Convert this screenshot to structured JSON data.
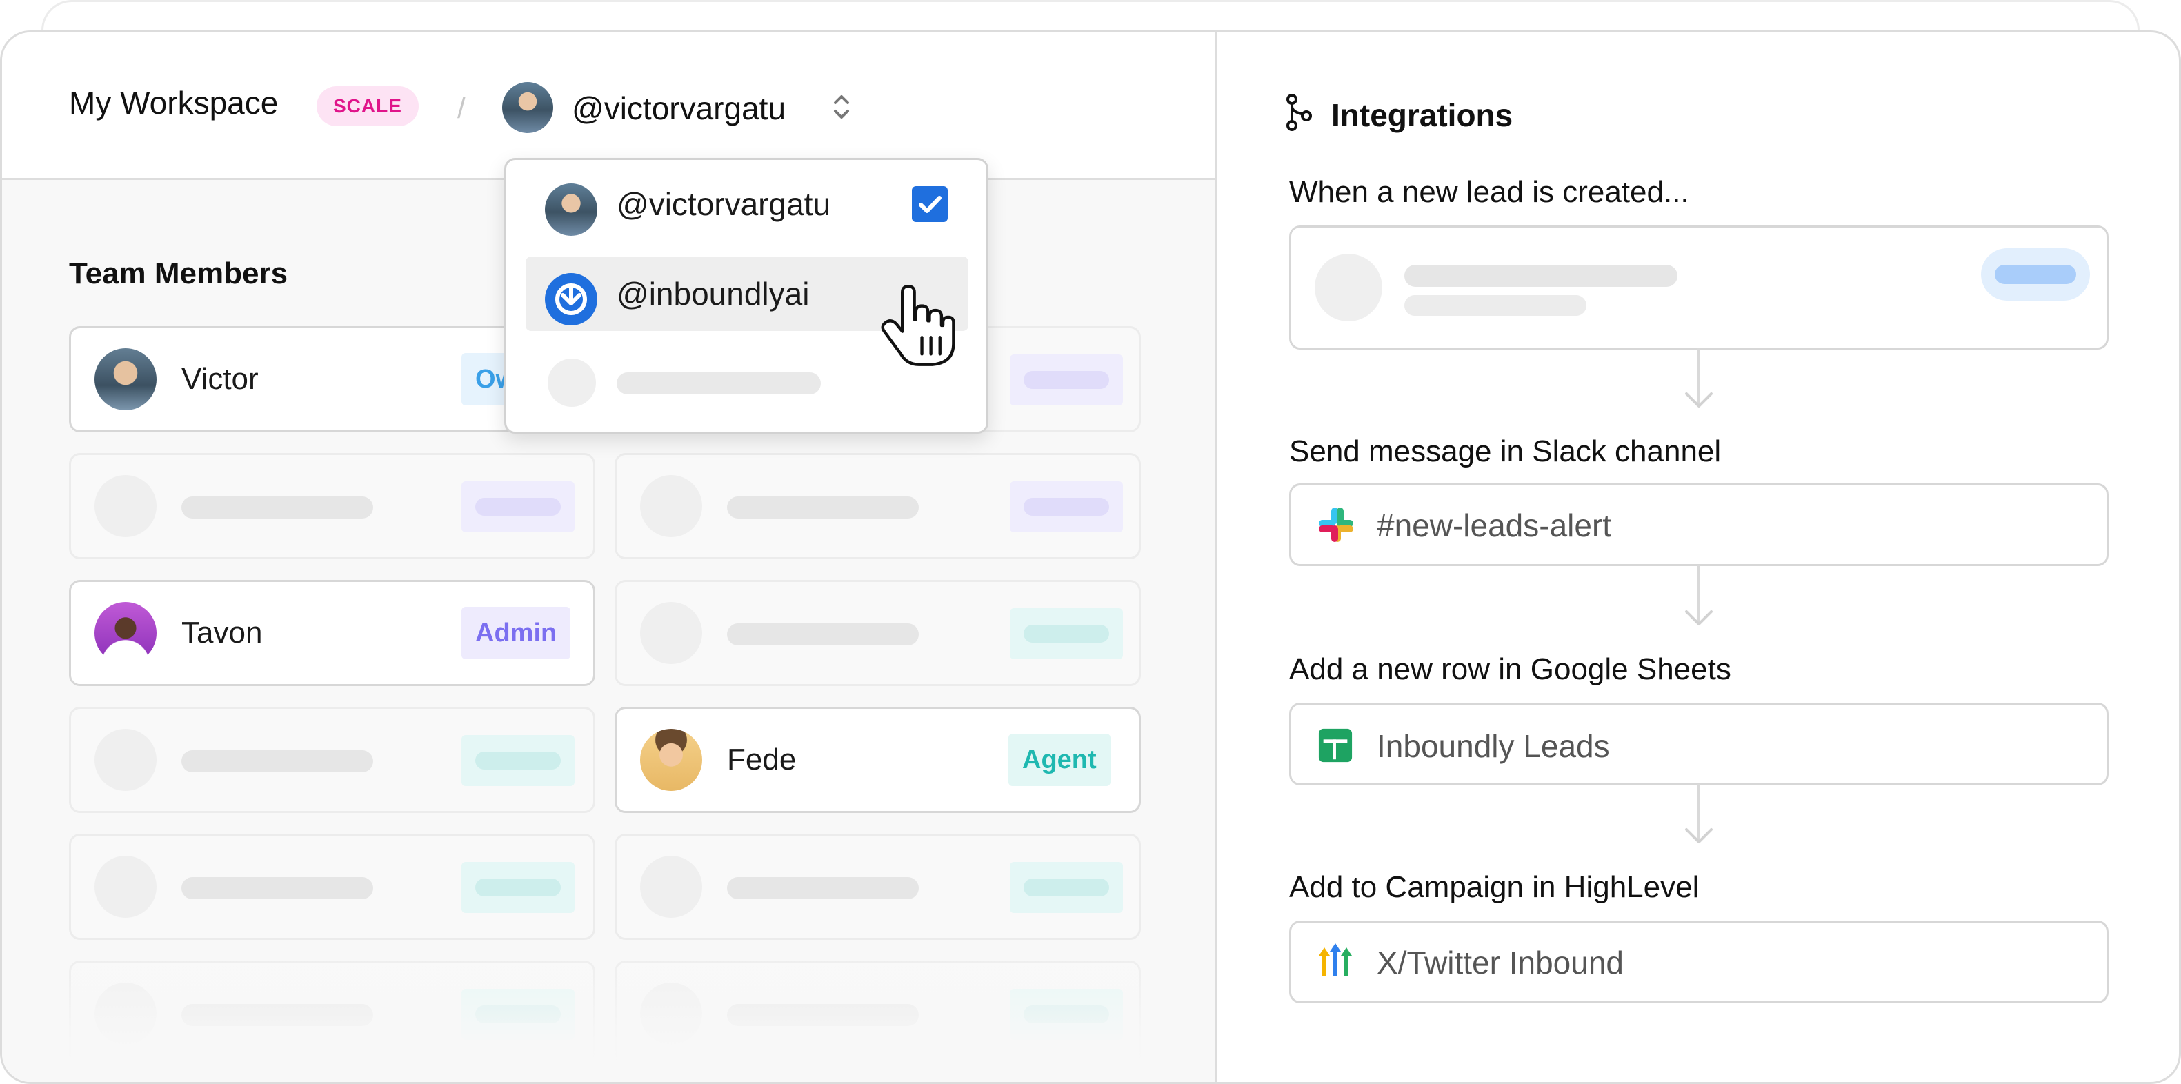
{
  "workspace": {
    "title": "My Workspace",
    "plan_badge": "SCALE",
    "separator": "/",
    "current_account": "@victorvargatu"
  },
  "account_menu": {
    "items": [
      {
        "handle": "@victorvargatu",
        "checked": true
      },
      {
        "handle": "@inboundlyai",
        "checked": false
      }
    ]
  },
  "team": {
    "title": "Team Members",
    "members": [
      {
        "name": "Victor",
        "role": "Owner"
      },
      {
        "name": "Tavon",
        "role": "Admin"
      },
      {
        "name": "Fede",
        "role": "Agent"
      }
    ]
  },
  "integrations": {
    "title": "Integrations",
    "steps": [
      {
        "label": "When a new lead is created...",
        "value": ""
      },
      {
        "label": "Send message in Slack channel",
        "value": "#new-leads-alert",
        "icon": "slack-icon"
      },
      {
        "label": "Add a new row in Google Sheets",
        "value": "Inboundly Leads",
        "icon": "google-sheets-icon"
      },
      {
        "label": "Add to Campaign in HighLevel",
        "value": "X/Twitter Inbound",
        "icon": "highlevel-icon"
      }
    ]
  },
  "colors": {
    "scale_badge_bg": "#fde3f4",
    "scale_badge_text": "#e0148a",
    "owner_role": "#3aa0e8",
    "admin_role": "#7b6ff0",
    "agent_role": "#1fb8b0",
    "checkbox": "#1f6fde"
  }
}
